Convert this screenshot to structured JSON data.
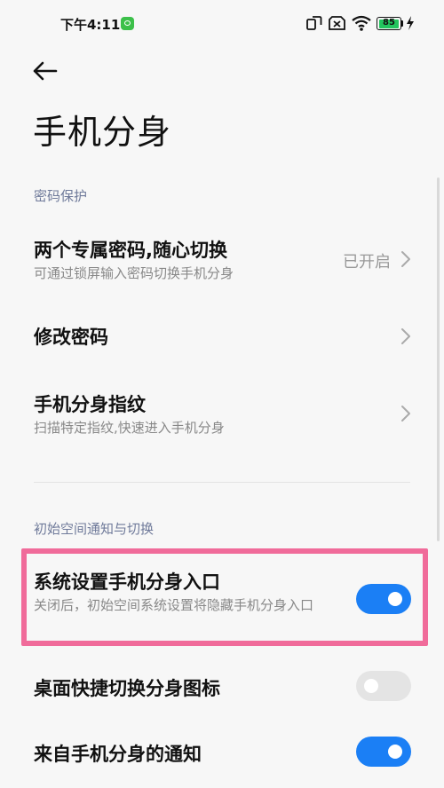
{
  "status_bar": {
    "time": "下午4:11",
    "battery_level": "85",
    "icons": [
      "wechat-icon",
      "screen-mirror-icon",
      "sim-off-icon",
      "wifi-icon",
      "battery-icon",
      "charging-icon"
    ]
  },
  "header": {
    "back_icon": "arrow-left-icon",
    "title": "手机分身"
  },
  "sections": {
    "password": {
      "header": "密码保护",
      "items": [
        {
          "title": "两个专属密码,随心切换",
          "subtitle": "可通过锁屏输入密码切换手机分身",
          "value": "已开启"
        },
        {
          "title": "修改密码"
        },
        {
          "title": "手机分身指纹",
          "subtitle": "扫描特定指纹,快速进入手机分身"
        }
      ]
    },
    "notify": {
      "header": "初始空间通知与切换",
      "items": [
        {
          "title": "系统设置手机分身入口",
          "subtitle": "关闭后，初始空间系统设置将隐藏手机分身入口",
          "toggle": true
        },
        {
          "title": "桌面快捷切换分身图标",
          "toggle": false
        },
        {
          "title": "来自手机分身的通知",
          "toggle": true
        }
      ]
    }
  },
  "colors": {
    "accent": "#1b7ff5",
    "highlight": "#f06b9a",
    "section_header": "#6f7a9a",
    "background": "#f7f7f7"
  }
}
